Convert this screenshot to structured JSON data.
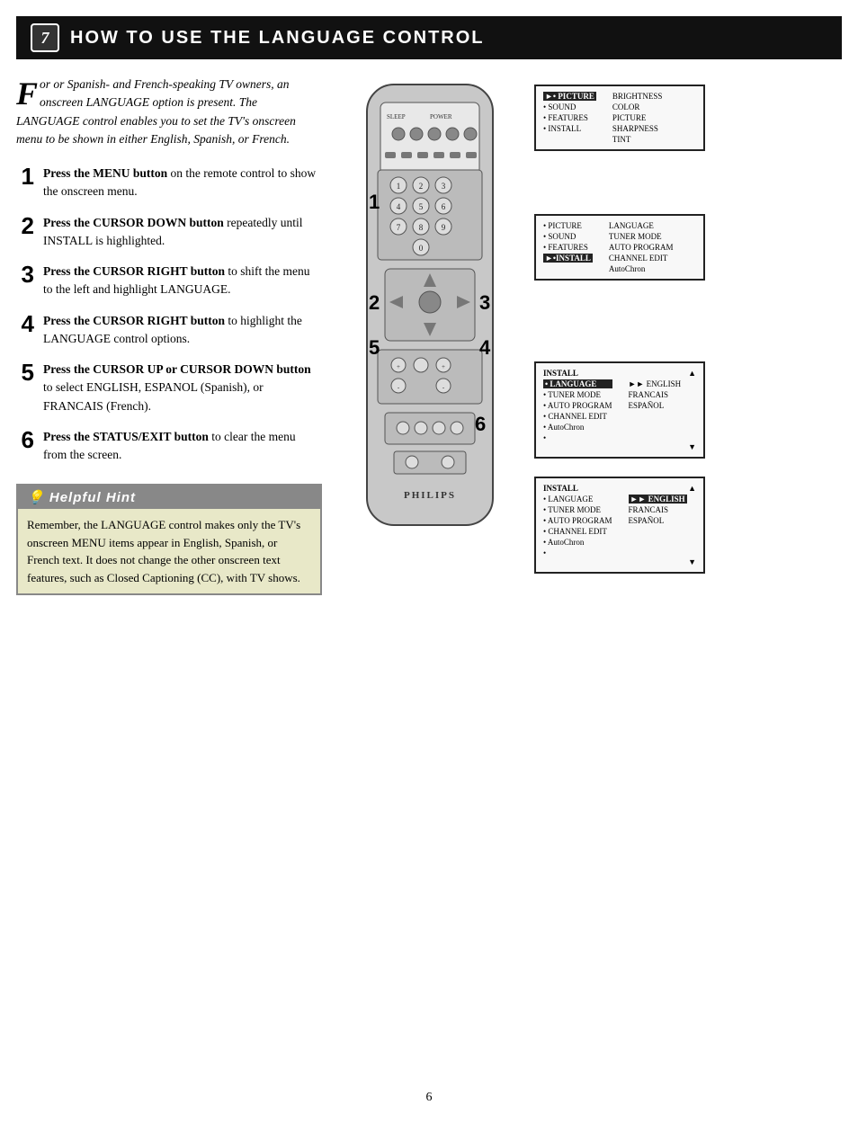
{
  "header": {
    "icon_text": "7",
    "title": "How to Use the Language Control"
  },
  "intro": {
    "drop_cap": "F",
    "text": "or or Spanish- and French-speaking TV owners, an onscreen LANGUAGE option is present. The LANGUAGE control enables you to set the TV's onscreen menu to be shown in either English, Spanish, or French."
  },
  "steps": [
    {
      "number": "1",
      "text": "Press the MENU button on the remote control to show the onscreen menu."
    },
    {
      "number": "2",
      "text": "Press the CURSOR DOWN button repeatedly until INSTALL is highlighted."
    },
    {
      "number": "3",
      "text": "Press the CURSOR RIGHT button to shift the menu to the left and highlight LANGUAGE."
    },
    {
      "number": "4",
      "text": "Press the CURSOR RIGHT button to highlight the LANGUAGE control options."
    },
    {
      "number": "5",
      "text": "Press the CURSOR UP or CURSOR DOWN button to select ENGLISH, ESPANOL (Spanish), or FRANCAIS (French)."
    },
    {
      "number": "6",
      "text": "Press the STATUS/EXIT button to clear the menu from the screen."
    }
  ],
  "hint": {
    "title": "Helpful Hint",
    "body": "Remember, the LANGUAGE control makes only the TV's onscreen MENU items appear in English, Spanish, or French text. It does not change the other onscreen text features, such as Closed Captioning (CC), with TV shows."
  },
  "screen1": {
    "left_items": [
      "►• PICTURE",
      "• SOUND",
      "• FEATURES",
      "• INSTALL"
    ],
    "right_items": [
      "BRIGHTNESS",
      "COLOR",
      "PICTURE",
      "SHARPNESS",
      "TINT"
    ]
  },
  "screen2": {
    "left_items": [
      "• PICTURE",
      "• SOUND",
      "• FEATURES",
      "►•INSTALL"
    ],
    "right_items": [
      "LANGUAGE",
      "TUNER MODE",
      "AUTO PROGRAM",
      "CHANNEL EDIT",
      "AutoChron"
    ]
  },
  "screen3": {
    "title": "INSTALL",
    "left_items": [
      "• LANGUAGE",
      "• TUNER MODE",
      "• AUTO PROGRAM",
      "• CHANNEL EDIT",
      "• AutoChron",
      "•"
    ],
    "right_items": [
      "►► ENGLISH",
      "FRANCAIS",
      "ESPAÑOL"
    ]
  },
  "screen4": {
    "title": "INSTALL",
    "left_items": [
      "• LANGUAGE",
      "• TUNER MODE",
      "• AUTO PROGRAM",
      "• CHANNEL EDIT",
      "• AutoChron",
      "•"
    ],
    "right_items": [
      "►► ENGLISH",
      "FRANCAIS",
      "ESPAÑOL"
    ]
  },
  "page_number": "6",
  "remote_brand": "PHILIPS"
}
